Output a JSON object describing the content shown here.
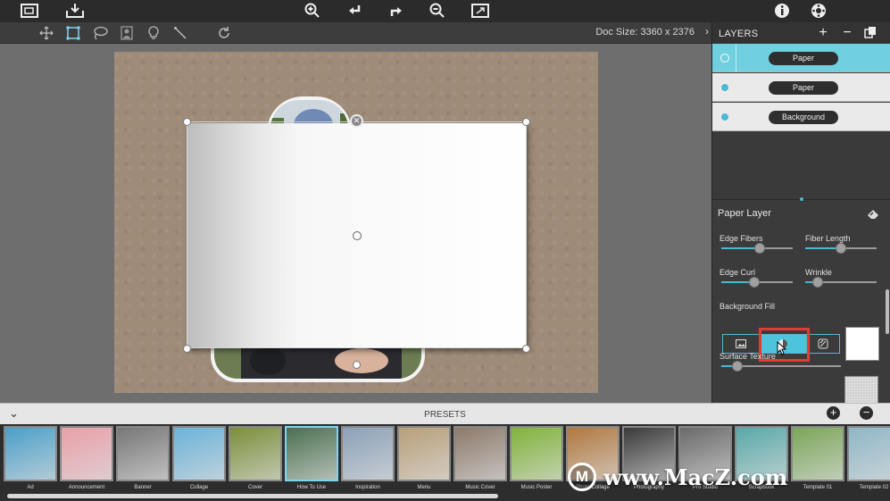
{
  "toolbar2": {
    "doc_size": "Doc Size: 3360 x 2376",
    "tools": [
      "move-tool",
      "crop-tool",
      "lasso-tool",
      "portrait-tool",
      "bulb-tool",
      "line-tool",
      "rotate-tool"
    ]
  },
  "layers": {
    "title": "LAYERS",
    "add": "+",
    "remove": "−",
    "items": [
      {
        "label": "Paper",
        "selected": true
      },
      {
        "label": "Paper",
        "selected": false
      },
      {
        "label": "Background",
        "selected": false
      }
    ]
  },
  "properties": {
    "title": "Paper Layer",
    "edge_fibers": {
      "label": "Edge Fibers",
      "value": 0.55
    },
    "fiber_length": {
      "label": "Fiber Length",
      "value": 0.5
    },
    "edge_curl": {
      "label": "Edge Curl",
      "value": 0.45
    },
    "wrinkle": {
      "label": "Wrinkle",
      "value": 0.12
    },
    "background_label": "Background Fill",
    "background_types": [
      "image-fill",
      "color-fill",
      "pattern-fill"
    ],
    "selected_background_type": "color-fill",
    "background_color": "#ffffff",
    "surface_texture": {
      "label": "Surface Texture",
      "value": 0.1
    }
  },
  "presets": {
    "title": "PRESETS",
    "items": [
      {
        "label": "Ad",
        "color": "#4a9fc9"
      },
      {
        "label": "Announcement",
        "color": "#e8a0a8"
      },
      {
        "label": "Banner",
        "color": "#777777"
      },
      {
        "label": "Collage",
        "color": "#6bb3d9"
      },
      {
        "label": "Cover",
        "color": "#7a8f3a"
      },
      {
        "label": "How To Use",
        "color": "#4a7050",
        "current": true
      },
      {
        "label": "Inspiration",
        "color": "#8ba1b8"
      },
      {
        "label": "Menu",
        "color": "#b89f79"
      },
      {
        "label": "Music Cover",
        "color": "#8c7a6b"
      },
      {
        "label": "Music Poster",
        "color": "#7fb33a"
      },
      {
        "label": "Photo Collage",
        "color": "#b07840"
      },
      {
        "label": "Photography",
        "color": "#3a3a3a"
      },
      {
        "label": "Pro Studio",
        "color": "#6a6a6a"
      },
      {
        "label": "Scrapbook",
        "color": "#58a9a8"
      },
      {
        "label": "Template 01",
        "color": "#7aa659"
      },
      {
        "label": "Template 02",
        "color": "#8fb7c7"
      }
    ]
  },
  "watermark": {
    "logo": "M",
    "text": "www.MacZ.com"
  }
}
